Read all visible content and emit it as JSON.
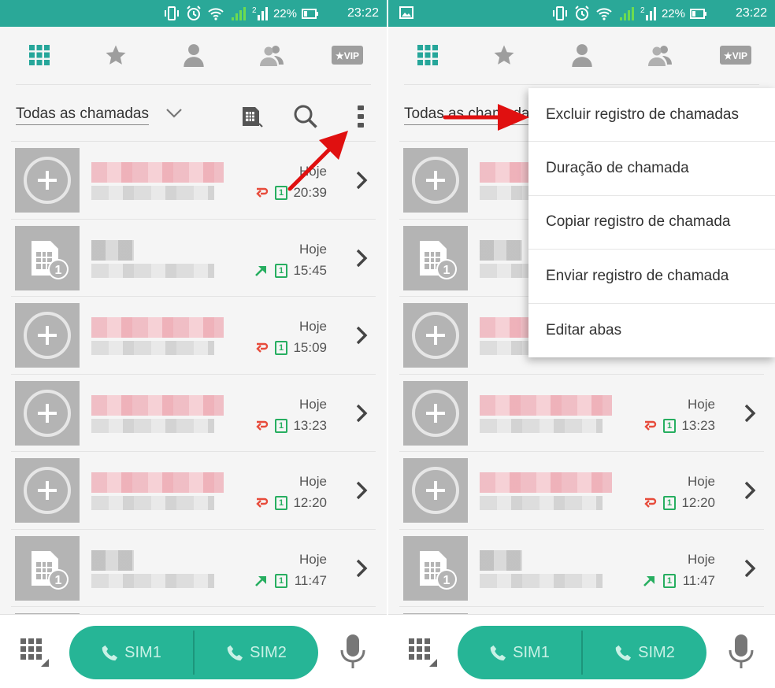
{
  "colors": {
    "accent": "#2aa898",
    "sim_pill": "#26b596",
    "missed": "#e74c3c",
    "outgoing": "#27ae60",
    "annotation_arrow": "#e01010"
  },
  "status_bar": {
    "battery_percent": "22%",
    "time": "23:22"
  },
  "tabs": [
    {
      "icon": "dialpad-grid-icon"
    },
    {
      "icon": "star-icon"
    },
    {
      "icon": "person-icon"
    },
    {
      "icon": "group-icon"
    },
    {
      "icon": "vip-icon",
      "label": "★VIP"
    }
  ],
  "filter": {
    "label": "Todas as chamadas"
  },
  "calls": [
    {
      "avatar": "add-contact-icon",
      "date": "Hoje",
      "time": "20:39",
      "type": "missed-call-icon",
      "sim": "1"
    },
    {
      "avatar": "sim-card-icon",
      "date": "Hoje",
      "time": "15:45",
      "type": "outgoing-call-icon",
      "sim": "1"
    },
    {
      "avatar": "add-contact-icon",
      "date": "Hoje",
      "time": "15:09",
      "type": "missed-call-icon",
      "sim": "1"
    },
    {
      "avatar": "add-contact-icon",
      "date": "Hoje",
      "time": "13:23",
      "type": "missed-call-icon",
      "sim": "1"
    },
    {
      "avatar": "add-contact-icon",
      "date": "Hoje",
      "time": "12:20",
      "type": "missed-call-icon",
      "sim": "1"
    },
    {
      "avatar": "sim-card-icon",
      "date": "Hoje",
      "time": "11:47",
      "type": "outgoing-call-icon",
      "sim": "1"
    }
  ],
  "bottom_bar": {
    "sim1_label": "SIM1",
    "sim2_label": "SIM2"
  },
  "overflow_menu": {
    "items": [
      "Excluir registro de chamadas",
      "Duração de chamada",
      "Copiar registro de chamada",
      "Enviar registro de chamada",
      "Editar abas"
    ]
  }
}
